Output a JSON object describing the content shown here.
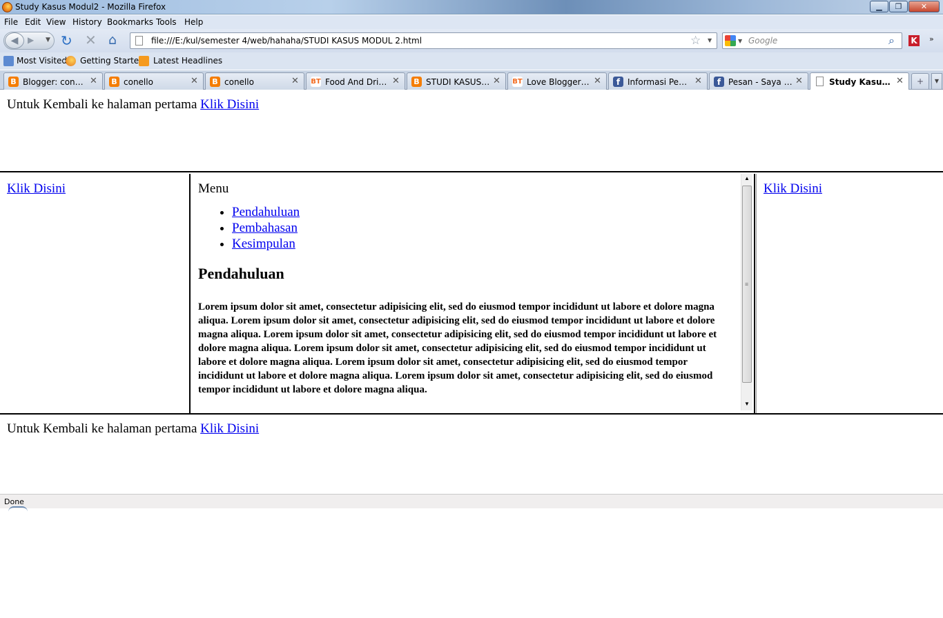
{
  "window": {
    "title": "Study Kasus Modul2 - Mozilla Firefox"
  },
  "menu": [
    "File",
    "Edit",
    "View",
    "History",
    "Bookmarks",
    "Tools",
    "Help"
  ],
  "toolbar": {
    "url": "file:///E:/kul/semester 4/web/hahaha/STUDI KASUS MODUL 2.html",
    "search_placeholder": "Google"
  },
  "bookmarks": [
    "Most Visited",
    "Getting Started",
    "Latest Headlines"
  ],
  "tabs": [
    {
      "label": "Blogger: conell...",
      "icon": "blogger-icon",
      "active": false
    },
    {
      "label": "conello",
      "icon": "blogger-icon",
      "active": false
    },
    {
      "label": "conello",
      "icon": "blogger-icon",
      "active": false
    },
    {
      "label": "Food And Drink...",
      "icon": "bt-icon",
      "active": false
    },
    {
      "label": "STUDI KASUS M...",
      "icon": "blogger-icon",
      "active": false
    },
    {
      "label": "Love Blogger Te...",
      "icon": "bt-icon",
      "active": false
    },
    {
      "label": "Informasi Pemu...",
      "icon": "facebook-icon",
      "active": false
    },
    {
      "label": "Pesan - Saya yg ...",
      "icon": "facebook-icon",
      "active": false
    },
    {
      "label": "Study Kasus M...",
      "icon": "page-icon",
      "active": true
    }
  ],
  "page": {
    "top_text": "Untuk Kembali ke halaman pertama",
    "top_link": "Klik Disini",
    "left_link": "Klik Disini",
    "right_link": "Klik Disini",
    "menu_title": "Menu",
    "menu_items": [
      "Pendahuluan",
      "Pembahasan",
      "Kesimpulan"
    ],
    "section_heading": "Pendahuluan",
    "body_text": "Lorem ipsum dolor sit amet, consectetur adipisicing elit, sed do eiusmod tempor incididunt ut labore et dolore magna aliqua. Lorem ipsum dolor sit amet, consectetur adipisicing elit, sed do eiusmod tempor incididunt ut labore et dolore magna aliqua. Lorem ipsum dolor sit amet, consectetur adipisicing elit, sed do eiusmod tempor incididunt ut labore et dolore magna aliqua. Lorem ipsum dolor sit amet, consectetur adipisicing elit, sed do eiusmod tempor incididunt ut labore et dolore magna aliqua. Lorem ipsum dolor sit amet, consectetur adipisicing elit, sed do eiusmod tempor incididunt ut labore et dolore magna aliqua. Lorem ipsum dolor sit amet, consectetur adipisicing elit, sed do eiusmod tempor incididunt ut labore et dolore magna aliqua.",
    "bottom_text": "Untuk Kembali ke halaman pertama",
    "bottom_link": "Klik Disini"
  },
  "status": {
    "text": "Done"
  },
  "colors": {
    "link": "#0000ee",
    "frame_border": "#000000",
    "status_bar": "#f0eeee"
  }
}
